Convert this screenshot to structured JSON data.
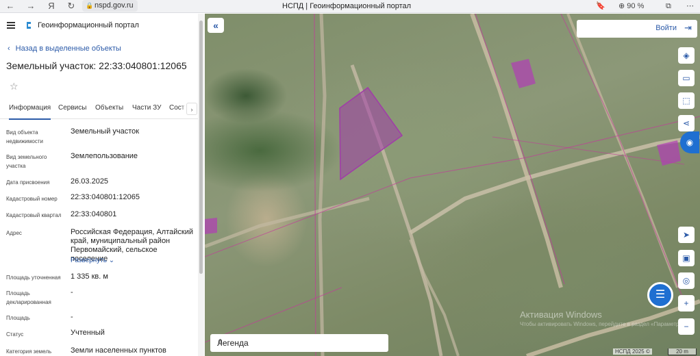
{
  "browser": {
    "url": "nspd.gov.ru",
    "tab_title": "НСПД | Геоинформационный портал",
    "zoom": "90 %"
  },
  "panel": {
    "portal_title": "Геоинформационный портал",
    "back_label": "Назад в выделенные объекты",
    "object_title": "Земельный участок: 22:33:040801:12065",
    "tabs": [
      "Информация",
      "Сервисы",
      "Объекты",
      "Части ЗУ",
      "Сост"
    ],
    "rows": [
      {
        "label": "Вид объекта недвижимости",
        "value": "Земельный участок"
      },
      {
        "label": "Вид земельного участка",
        "value": "Землепользование"
      },
      {
        "label": "Дата присвоения",
        "value": "26.03.2025"
      },
      {
        "label": "Кадастровый номер",
        "value": "22:33:040801:12065"
      },
      {
        "label": "Кадастровый квартал",
        "value": "22:33:040801"
      },
      {
        "label": "Адрес",
        "value": "Российская Федерация, Алтайский край, муниципальный район Первомайский, сельское поселение"
      },
      {
        "label": "Площадь уточненная",
        "value": "1 335 кв. м"
      },
      {
        "label": "Площадь декларированная",
        "value": "-"
      },
      {
        "label": "Площадь",
        "value": "-"
      },
      {
        "label": "Статус",
        "value": "Учтенный"
      },
      {
        "label": "Категория земель",
        "value": "Земли населенных пунктов"
      }
    ],
    "expand_label": "Развернуть"
  },
  "map": {
    "login_label": "Войти",
    "legend_label": "Легенда",
    "watermark": "Активация Windows",
    "watermark_sub": "Чтобы активировать Windows, перейдите в раздел «Параметры».",
    "attribution": "НСПД 2025 ©",
    "scale_label": "20 m",
    "tools": [
      "layers-icon",
      "ruler-icon",
      "select-area-icon",
      "share-icon"
    ],
    "bottom_tools": [
      "locate-icon",
      "print-icon",
      "point-search-icon",
      "zoom-in-icon",
      "zoom-out-icon"
    ]
  },
  "colors": {
    "accent": "#2b5aa8",
    "parcel": "#a03ca8",
    "chat": "#1f6fd1"
  }
}
